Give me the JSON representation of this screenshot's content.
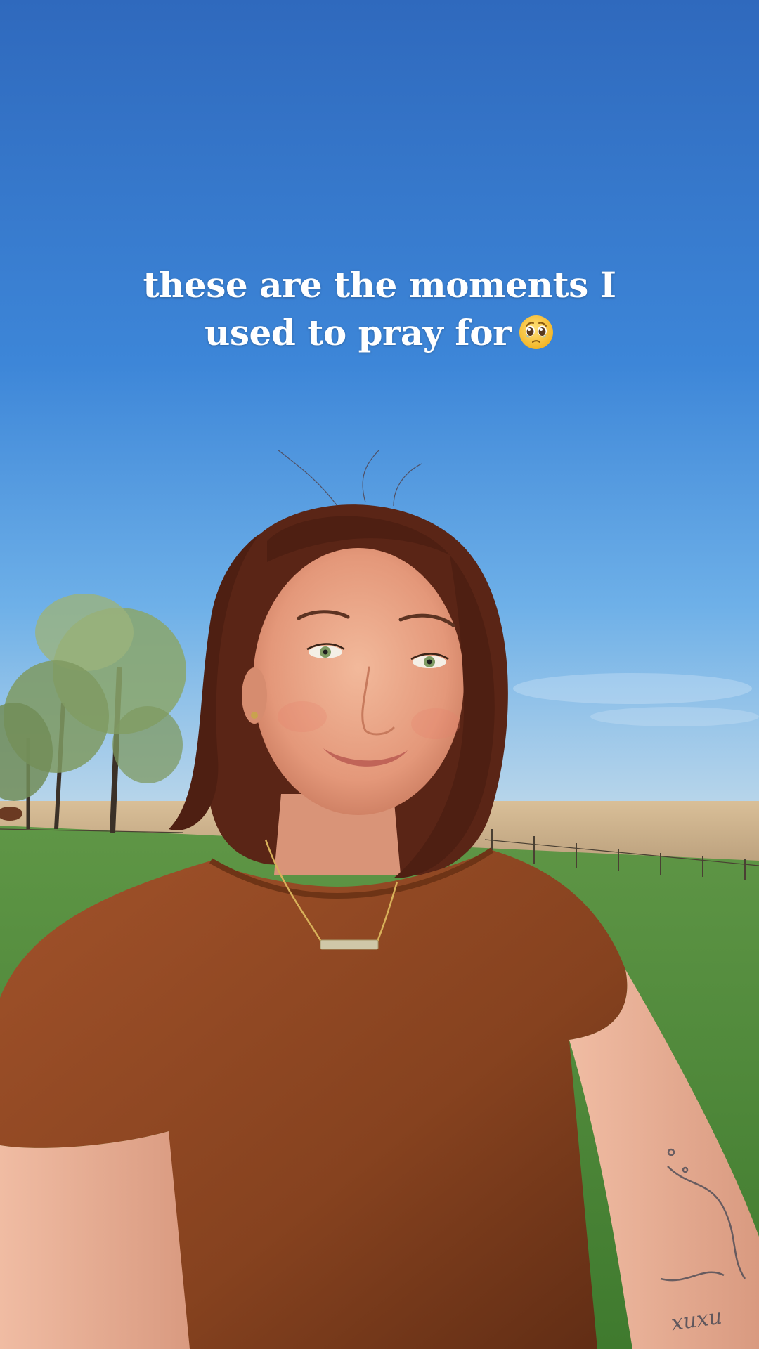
{
  "caption": {
    "line1": "these are the moments I",
    "line2": "used to pray for",
    "emoji": "pleading-face-emoji"
  },
  "tattoo": {
    "text": "xuxu"
  },
  "colors": {
    "sky_top": "#2f6cc0",
    "sky_bottom": "#7bb8ea",
    "grass": "#4e8a3a",
    "field": "#cdb08c",
    "shirt": "#8a4420",
    "hair": "#5a2516",
    "skin": "#e9a487",
    "caption_text": "#ffffff"
  }
}
